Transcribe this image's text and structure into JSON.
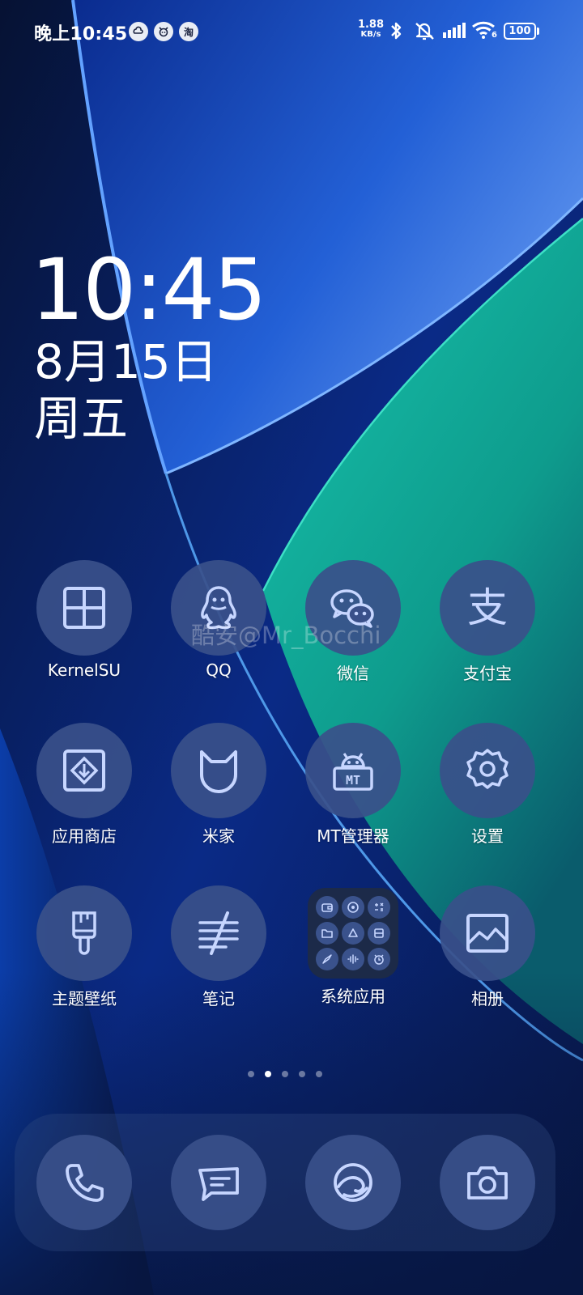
{
  "status_bar": {
    "time": "晚上10:45",
    "notifications": [
      "cloud-link-icon",
      "alarm-bot-icon",
      "taobao-icon"
    ],
    "taobao_glyph": "淘",
    "net_speed_value": "1.88",
    "net_speed_unit": "KB/s",
    "wifi_label": "6",
    "battery": "100"
  },
  "clock": {
    "time": "10:45",
    "date": "8月15日",
    "weekday": "周五"
  },
  "apps": [
    {
      "label": "KernelSU",
      "icon": "grid-window-icon"
    },
    {
      "label": "QQ",
      "icon": "qq-penguin-icon"
    },
    {
      "label": "微信",
      "icon": "wechat-bubbles-icon"
    },
    {
      "label": "支付宝",
      "icon": "alipay-icon"
    },
    {
      "label": "应用商店",
      "icon": "app-store-icon"
    },
    {
      "label": "米家",
      "icon": "mijia-cat-icon"
    },
    {
      "label": "MT管理器",
      "icon": "mt-manager-icon"
    },
    {
      "label": "设置",
      "icon": "gear-icon"
    },
    {
      "label": "主题壁纸",
      "icon": "paintbrush-icon"
    },
    {
      "label": "笔记",
      "icon": "notes-icon"
    },
    {
      "label": "系统应用",
      "icon": "system-apps-folder-icon"
    },
    {
      "label": "相册",
      "icon": "gallery-icon"
    }
  ],
  "mt_badge": "MT",
  "alipay_glyph": "支",
  "folder_items": [
    "wallet-icon",
    "compass-icon",
    "calculator-icon",
    "folder-icon",
    "assistant-icon",
    "scanner-icon",
    "compass-needle-icon",
    "recorder-icon",
    "clock-icon"
  ],
  "watermark": "酷安@Mr_Bocchi",
  "pages": {
    "count": 5,
    "active": 1
  },
  "dock": [
    "phone-icon",
    "messages-icon",
    "browser-icon",
    "camera-icon"
  ]
}
